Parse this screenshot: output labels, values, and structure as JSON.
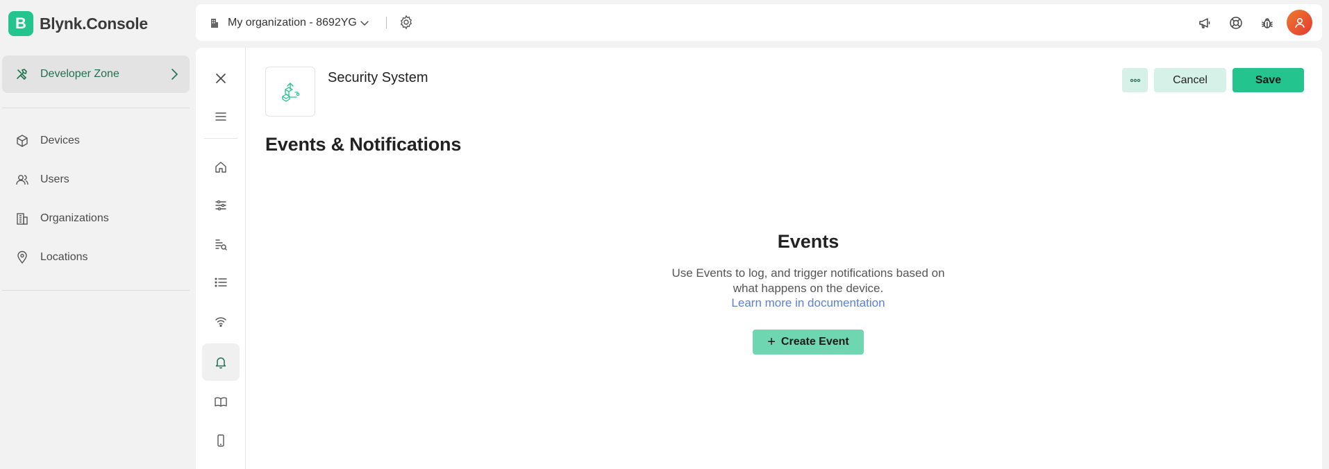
{
  "brand": {
    "logo_letter": "B",
    "name": "Blynk.Console",
    "color": "#23c48e"
  },
  "sidebar": {
    "developer_zone": "Developer Zone",
    "items": [
      {
        "label": "Devices",
        "icon": "cube-icon"
      },
      {
        "label": "Users",
        "icon": "users-icon"
      },
      {
        "label": "Organizations",
        "icon": "building-icon"
      },
      {
        "label": "Locations",
        "icon": "location-pin-icon"
      }
    ]
  },
  "topbar": {
    "organization": "My organization - 8692YG",
    "icons": [
      "megaphone-icon",
      "help-lifebuoy-icon",
      "bug-icon",
      "avatar"
    ]
  },
  "rail": {
    "items": [
      "close-icon",
      "menu-icon",
      "home-icon",
      "settings-sliders-icon",
      "datastreams-icon",
      "list-icon",
      "wifi-icon",
      "bell-icon",
      "book-icon",
      "mobile-icon"
    ],
    "active": "bell-icon"
  },
  "template": {
    "name": "Security System"
  },
  "page": {
    "title": "Events & Notifications"
  },
  "actions": {
    "more": "more-icon",
    "cancel": "Cancel",
    "save": "Save"
  },
  "empty_state": {
    "title": "Events",
    "description": "Use Events to log, and trigger notifications based on what happens on the device.",
    "link": "Learn more in documentation",
    "button": "Create Event",
    "button_icon": "+"
  }
}
